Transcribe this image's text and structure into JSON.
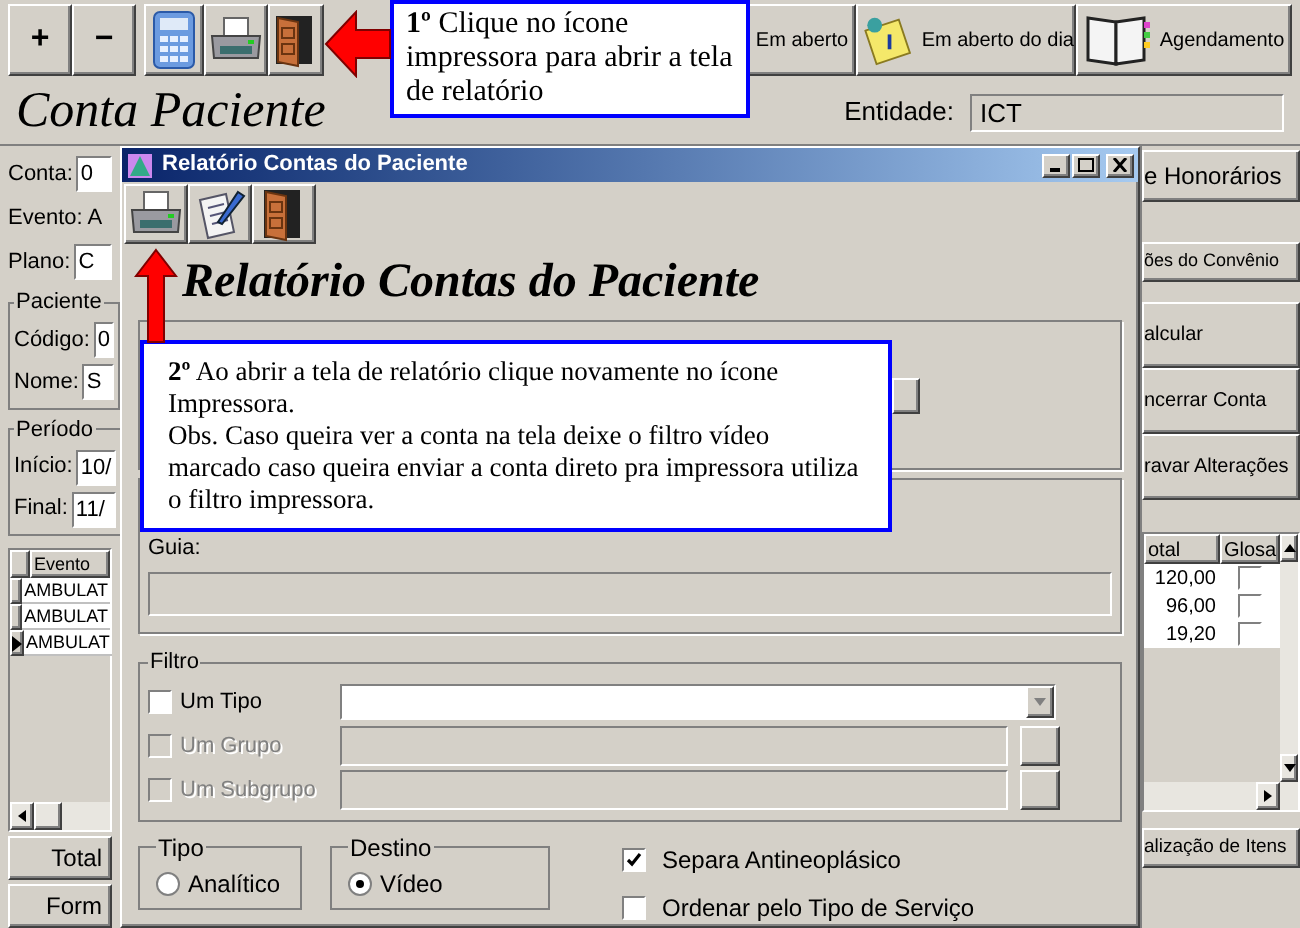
{
  "main": {
    "toolbar": [
      {
        "kind": "text",
        "label": "+"
      },
      {
        "kind": "text",
        "label": "−"
      },
      {
        "kind": "calculator"
      },
      {
        "kind": "printer"
      },
      {
        "kind": "door"
      },
      {
        "kind": "labeled",
        "label": "Em aberto"
      },
      {
        "kind": "note",
        "label": "Em aberto do dia"
      },
      {
        "kind": "book",
        "label": "Agendamento"
      }
    ],
    "title": "Conta Paciente",
    "entidade": {
      "label": "Entidade:",
      "value": "ICT"
    },
    "fields": [
      {
        "label": "Conta:",
        "value": "0"
      },
      {
        "label": "Evento: A"
      },
      {
        "label": "Plano:",
        "value": "C"
      }
    ],
    "groups": [
      {
        "legend": "Paciente",
        "fields": [
          {
            "label": "Código:",
            "value": "0"
          },
          {
            "label": "Nome:",
            "value": "S"
          }
        ]
      },
      {
        "legend": "Período",
        "fields": [
          {
            "label": "Início:",
            "value": "10/"
          },
          {
            "label": "Final:",
            "value": "11/"
          }
        ]
      }
    ],
    "events_table": {
      "columns": [
        "Evento"
      ],
      "rows": [
        {
          "cells": [
            "AMBULAT"
          ],
          "selected": false
        },
        {
          "cells": [
            "AMBULAT"
          ],
          "selected": false
        },
        {
          "cells": [
            "AMBULAT"
          ],
          "selected": true
        }
      ]
    },
    "bottom_buttons": [
      "Total",
      "Form"
    ],
    "right_buttons": [
      "e Honorários",
      "ões do Convênio",
      "alcular",
      "ncerrar Conta",
      "ravar Alterações"
    ],
    "values_table": {
      "columns": [
        "otal",
        "Glosa"
      ],
      "rows": [
        {
          "value": "120,00",
          "glosa": false
        },
        {
          "value": "96,00",
          "glosa": false
        },
        {
          "value": "19,20",
          "glosa": false
        }
      ]
    },
    "itens_button": "alização de Itens"
  },
  "dialog": {
    "title": "Relatório Contas do Paciente",
    "toolbar": [
      {
        "kind": "printer"
      },
      {
        "kind": "notes"
      },
      {
        "kind": "door"
      }
    ],
    "heading": "Relatório Contas do Paciente",
    "guia_label": "Guia:",
    "filtro": {
      "legend": "Filtro",
      "rows": [
        {
          "label": "Um Tipo",
          "checked": false,
          "disabled": false,
          "kind": "combo"
        },
        {
          "label": "Um Grupo",
          "checked": false,
          "disabled": true,
          "kind": "lookup"
        },
        {
          "label": "Um Subgrupo",
          "checked": false,
          "disabled": true,
          "kind": "lookup"
        }
      ]
    },
    "tipo": {
      "legend": "Tipo",
      "options": [
        {
          "label": "Analítico",
          "selected": false
        }
      ]
    },
    "destino": {
      "legend": "Destino",
      "options": [
        {
          "label": "Vídeo",
          "selected": true
        }
      ]
    },
    "options": [
      {
        "label": "Separa Antineoplásico",
        "checked": true
      },
      {
        "label": "Ordenar pelo Tipo de Serviço",
        "checked": false
      }
    ]
  },
  "callouts": [
    {
      "paragraphs": [
        "**1º** Clique no ícone impressora para abrir a tela de relatório"
      ]
    },
    {
      "paragraphs": [
        "**2º** Ao abrir a tela de relatório clique novamente no ícone Impressora.",
        "Obs. Caso queira ver a conta na tela deixe o filtro vídeo marcado caso queira enviar a conta direto pra impressora utiliza o filtro impressora."
      ]
    }
  ]
}
